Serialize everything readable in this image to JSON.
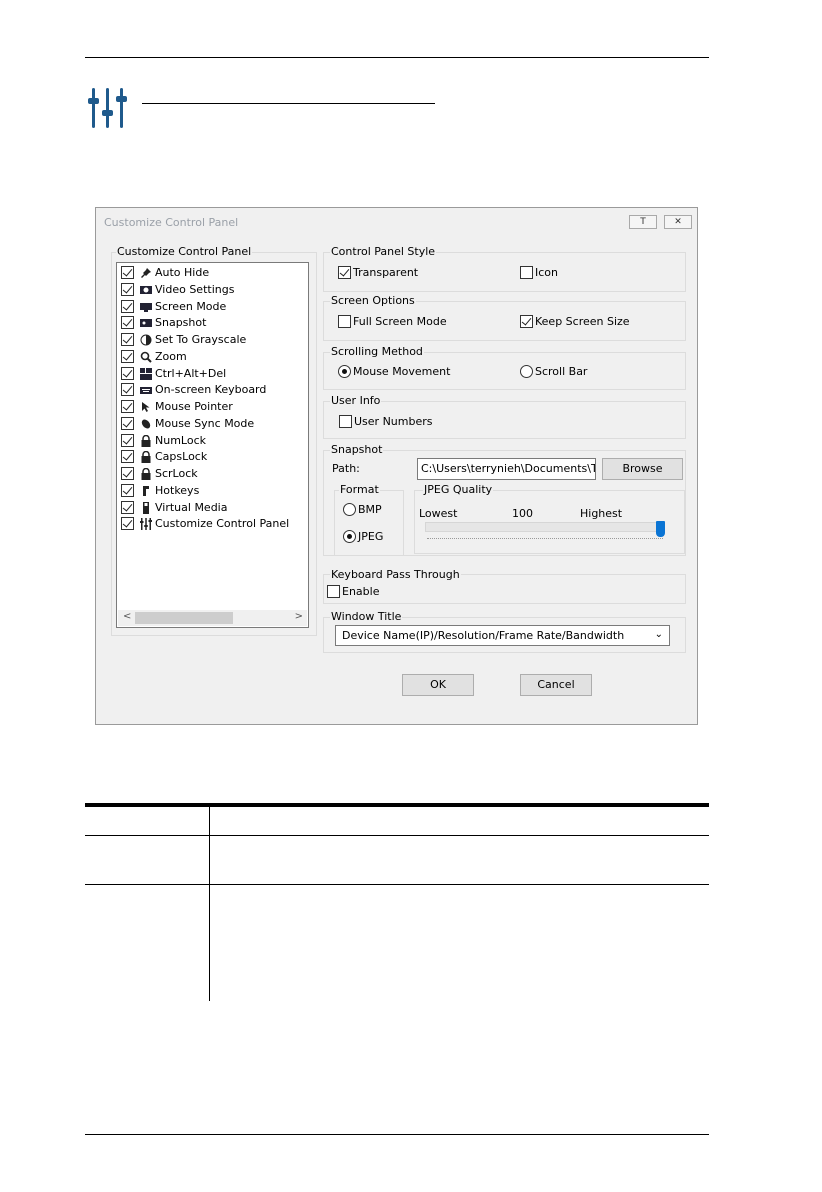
{
  "dialog": {
    "title": "Customize Control Panel",
    "help_button": "T",
    "close_button": "✕",
    "left_group_label": "Customize Control Panel",
    "items": [
      {
        "label": "Auto Hide",
        "checked": true,
        "icon": "pin-icon"
      },
      {
        "label": "Video Settings",
        "checked": true,
        "icon": "video-settings-icon"
      },
      {
        "label": "Screen Mode",
        "checked": true,
        "icon": "screen-mode-icon"
      },
      {
        "label": "Snapshot",
        "checked": true,
        "icon": "snapshot-icon"
      },
      {
        "label": "Set To Grayscale",
        "checked": true,
        "icon": "grayscale-icon"
      },
      {
        "label": "Zoom",
        "checked": true,
        "icon": "zoom-icon"
      },
      {
        "label": "Ctrl+Alt+Del",
        "checked": true,
        "icon": "ctrl-alt-del-icon"
      },
      {
        "label": "On-screen Keyboard",
        "checked": true,
        "icon": "keyboard-icon"
      },
      {
        "label": "Mouse Pointer",
        "checked": true,
        "icon": "mouse-pointer-icon"
      },
      {
        "label": "Mouse Sync Mode",
        "checked": true,
        "icon": "mouse-sync-icon"
      },
      {
        "label": "NumLock",
        "checked": true,
        "icon": "lock-icon"
      },
      {
        "label": "CapsLock",
        "checked": true,
        "icon": "lock-icon"
      },
      {
        "label": "ScrLock",
        "checked": true,
        "icon": "lock-icon"
      },
      {
        "label": "Hotkeys",
        "checked": true,
        "icon": "hotkeys-icon"
      },
      {
        "label": "Virtual Media",
        "checked": true,
        "icon": "virtual-media-icon"
      },
      {
        "label": "Customize Control Panel",
        "checked": true,
        "icon": "sliders-icon"
      }
    ],
    "scroll_left": "<",
    "scroll_right": ">",
    "control_panel_style": {
      "label": "Control Panel Style",
      "transparent": "Transparent",
      "transparent_checked": true,
      "icon": "Icon",
      "icon_checked": false
    },
    "screen_options": {
      "label": "Screen Options",
      "full_screen": "Full Screen Mode",
      "full_screen_checked": false,
      "keep_size": "Keep Screen Size",
      "keep_size_checked": true
    },
    "scrolling_method": {
      "label": "Scrolling Method",
      "mouse_movement": "Mouse Movement",
      "scroll_bar": "Scroll Bar",
      "selected": "mouse_movement"
    },
    "user_info": {
      "label": "User Info",
      "user_numbers": "User Numbers",
      "user_numbers_checked": false
    },
    "snapshot": {
      "label": "Snapshot",
      "path_label": "Path:",
      "path_value": "C:\\Users\\terrynieh\\Documents\\To Me",
      "browse": "Browse",
      "format_label": "Format",
      "bmp": "BMP",
      "jpeg": "JPEG",
      "format_selected": "jpeg",
      "quality_label": "JPEG Quality",
      "lowest": "Lowest",
      "value": "100",
      "highest": "Highest",
      "quality_fraction": 1.0
    },
    "keyboard_pass_through": {
      "label": "Keyboard Pass Through",
      "enable": "Enable",
      "enable_checked": false
    },
    "window_title": {
      "label": "Window Title",
      "selected": "Device Name(IP)/Resolution/Frame Rate/Bandwidth"
    },
    "ok": "OK",
    "cancel": "Cancel"
  },
  "colors": {
    "accent": "#0a74d4",
    "icon_blue": "#1f5a8c",
    "dialog_bg": "#f0f0f0"
  }
}
